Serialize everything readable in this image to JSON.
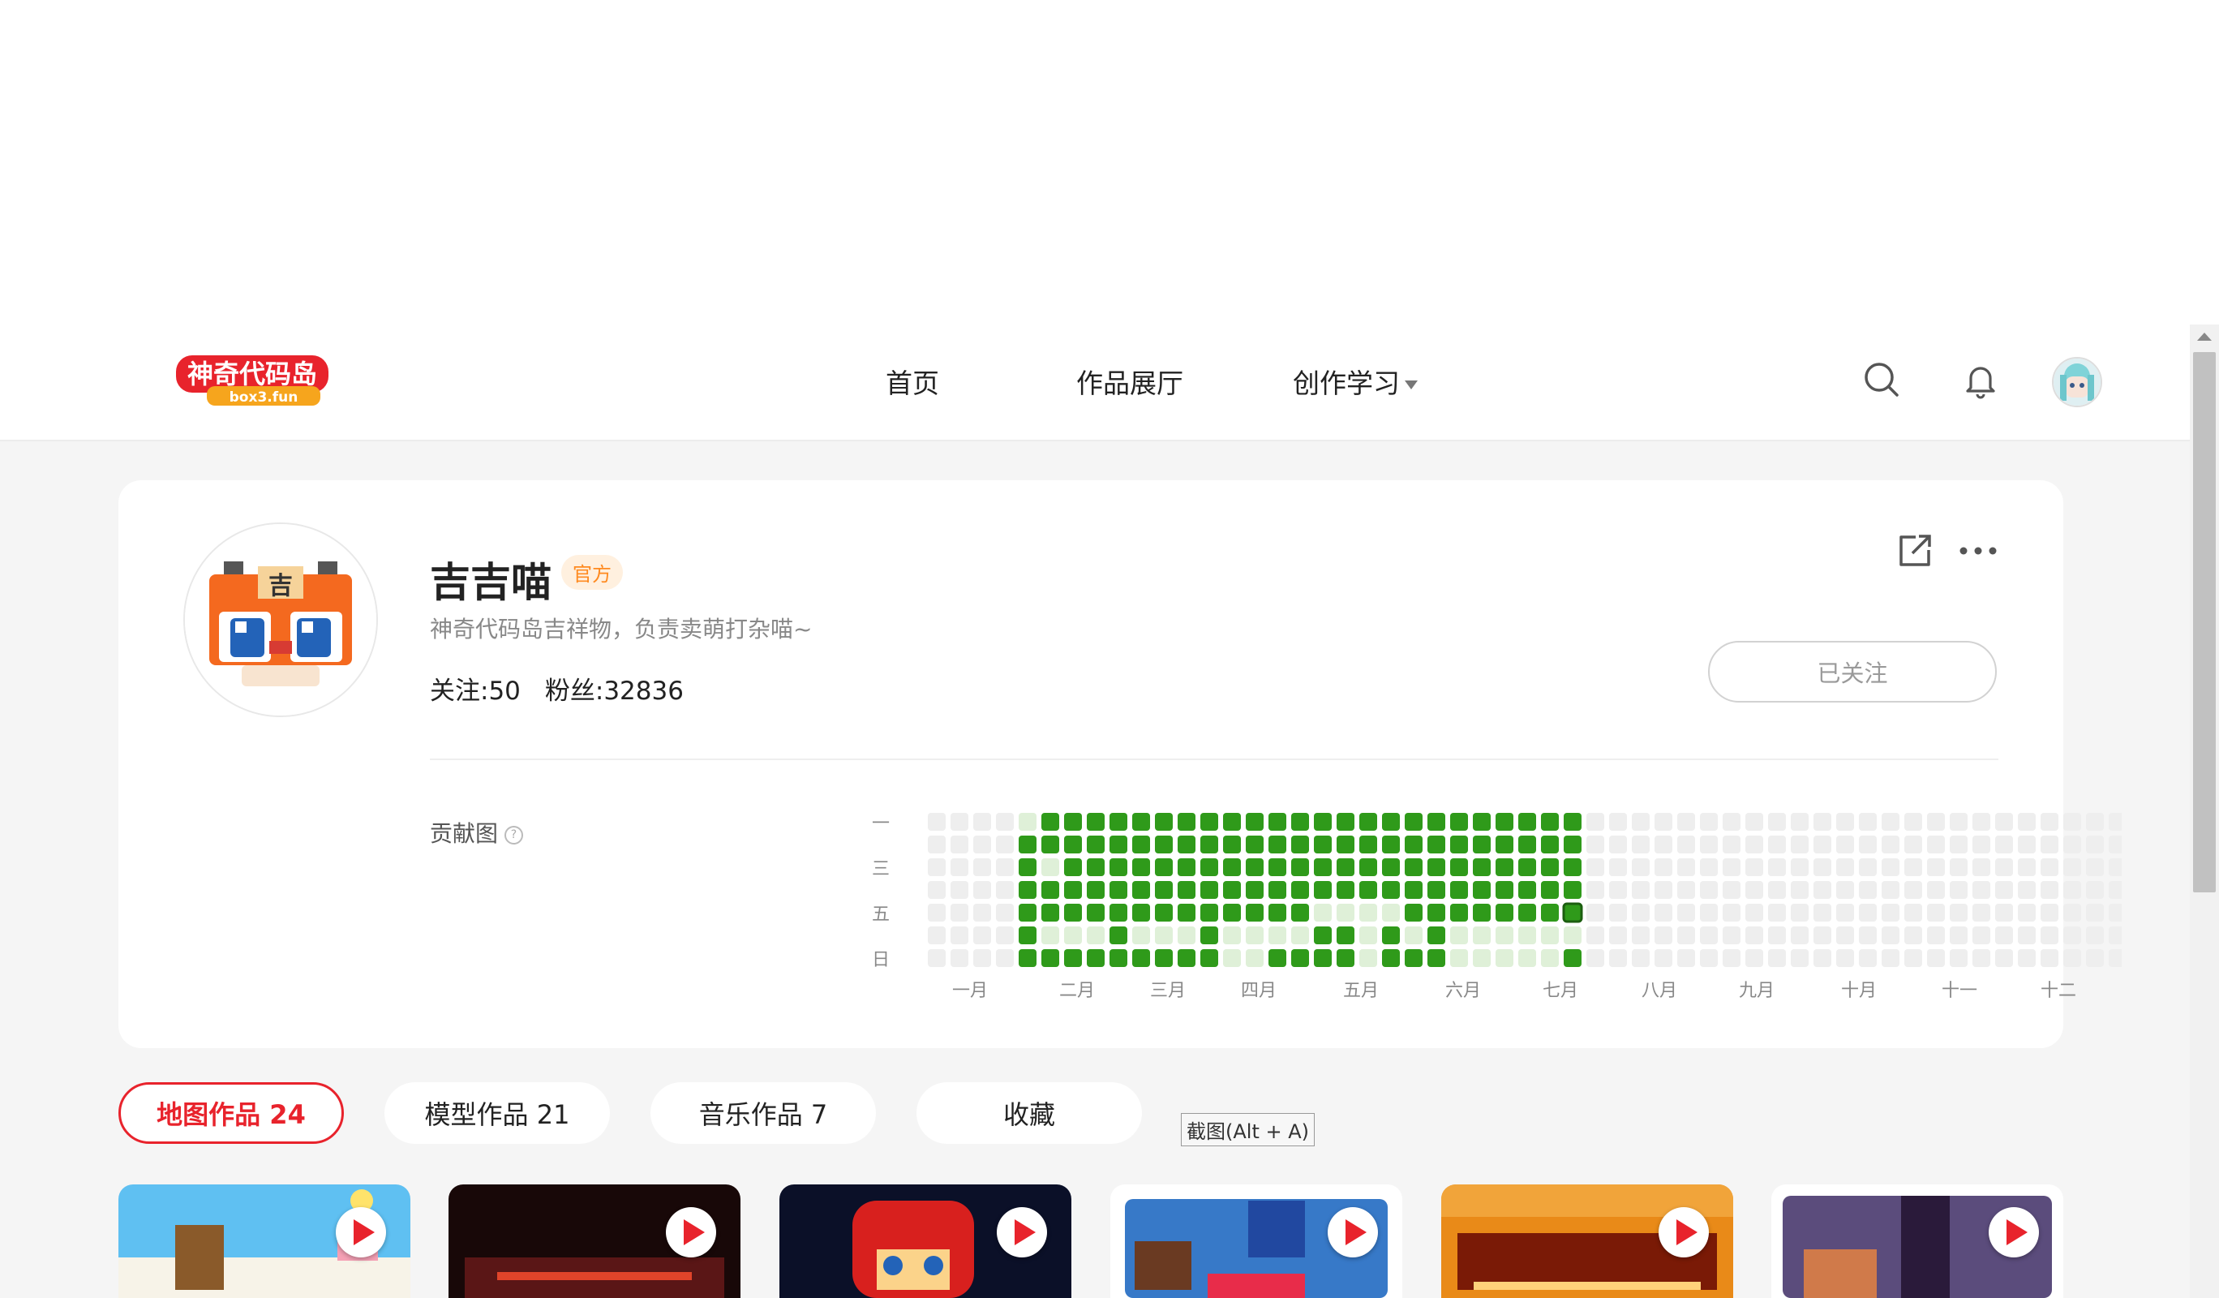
{
  "nav": {
    "logo_text": "神奇代码岛",
    "logo_sub": "box3.fun",
    "items": [
      {
        "label": "首页"
      },
      {
        "label": "作品展厅"
      },
      {
        "label": "创作学习"
      }
    ],
    "icons": [
      "search-icon",
      "bell-icon",
      "user-avatar"
    ]
  },
  "profile": {
    "name": "吉吉喵",
    "badge": "官方",
    "bio": "神奇代码岛吉祥物，负责卖萌打杂喵~",
    "following_label": "关注:50",
    "followers_label": "粉丝:32836",
    "follow_button": "已关注",
    "contribution_label": "贡献图"
  },
  "contribution": {
    "weekday_labels": [
      "一",
      "三",
      "五",
      "日"
    ],
    "month_labels": [
      "一月",
      "二月",
      "三月",
      "四月",
      "五月",
      "六月",
      "七月",
      "八月",
      "九月",
      "十月",
      "十一",
      "十二"
    ],
    "weeks": 53,
    "first_active_week": 4,
    "last_active_week": 28,
    "colors": {
      "empty": "#eeeeee",
      "low": "#dff0d8",
      "high": "#2f9a1a"
    },
    "sparse_weeks_row6": [
      4,
      8
    ],
    "sparse_weeks_row7": [
      4,
      5,
      6,
      7,
      8,
      9,
      10,
      11,
      12,
      15,
      16,
      17,
      18,
      20,
      21,
      22,
      28
    ],
    "sparse_weeks_row1": [
      5
    ]
  },
  "tabs": [
    {
      "label": "地图作品 24",
      "active": true
    },
    {
      "label": "模型作品 21",
      "active": false
    },
    {
      "label": "音乐作品 7",
      "active": false
    },
    {
      "label": "收藏",
      "active": false
    }
  ],
  "tooltip": "截图(Alt + A)",
  "cards": [
    {
      "color": "#4fb6ee"
    },
    {
      "color": "#1a0b0b"
    },
    {
      "color": "#0a0f24"
    },
    {
      "color": "#3a7bd0"
    },
    {
      "color": "#e07a12"
    },
    {
      "color": "#6b5a8a"
    }
  ]
}
